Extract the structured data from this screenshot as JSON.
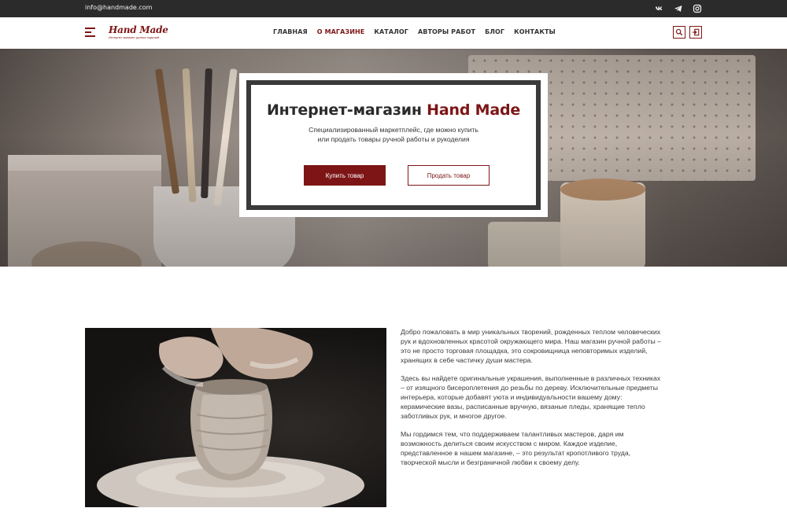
{
  "topbar": {
    "email": "info@handmade.com",
    "socials": [
      {
        "icon": "vk-icon"
      },
      {
        "icon": "telegram-icon"
      },
      {
        "icon": "instagram-icon"
      }
    ]
  },
  "header": {
    "logo_text": "Hand Made",
    "logo_tagline": "Интернет-магазин ручных изделий",
    "nav": [
      {
        "label": "ГЛАВНАЯ",
        "active": false
      },
      {
        "label": "О МАГАЗИНЕ",
        "active": true
      },
      {
        "label": "КАТАЛОГ",
        "active": false
      },
      {
        "label": "АВТОРЫ РАБОТ",
        "active": false
      },
      {
        "label": "БЛОГ",
        "active": false
      },
      {
        "label": "КОНТАКТЫ",
        "active": false
      }
    ],
    "search_icon": "search-icon",
    "login_icon": "login-icon"
  },
  "hero": {
    "title_prefix": "Интернет-магазин ",
    "title_accent": "Hand Made",
    "subtitle_line1": "Специализированный маркетплейс, где можно купить",
    "subtitle_line2": "или продать товары ручной работы и рукоделия",
    "buy_label": "Купить товар",
    "sell_label": "Продать товар"
  },
  "about": {
    "paragraphs": [
      "Добро пожаловать в мир уникальных творений, рожденных теплом человеческих рук и вдохновленных красотой окружающего мира. Наш магазин ручной работы – это не просто торговая площадка, это сокровищница неповторимых изделий, хранящих в себе частичку души мастера.",
      "Здесь вы найдете оригинальные украшения, выполненные в различных техниках – от изящного бисероплетения до резьбы по дереву. Исключительные предметы интерьера, которые добавят уюта и индивидуальности вашему дому: керамические вазы, расписанные вручную, вязаные пледы, хранящие тепло заботливых рук, и многое другое.",
      "Мы гордимся тем, что поддерживаем талантливых мастеров, даря им возможность делиться своим искусством с миром. Каждое изделие, представленное в нашем магазине, – это результат кропотливого труда, творческой мысли и безграничной любви к своему делу."
    ]
  },
  "colors": {
    "accent": "#7d1516",
    "topbar": "#2b2b2b"
  }
}
